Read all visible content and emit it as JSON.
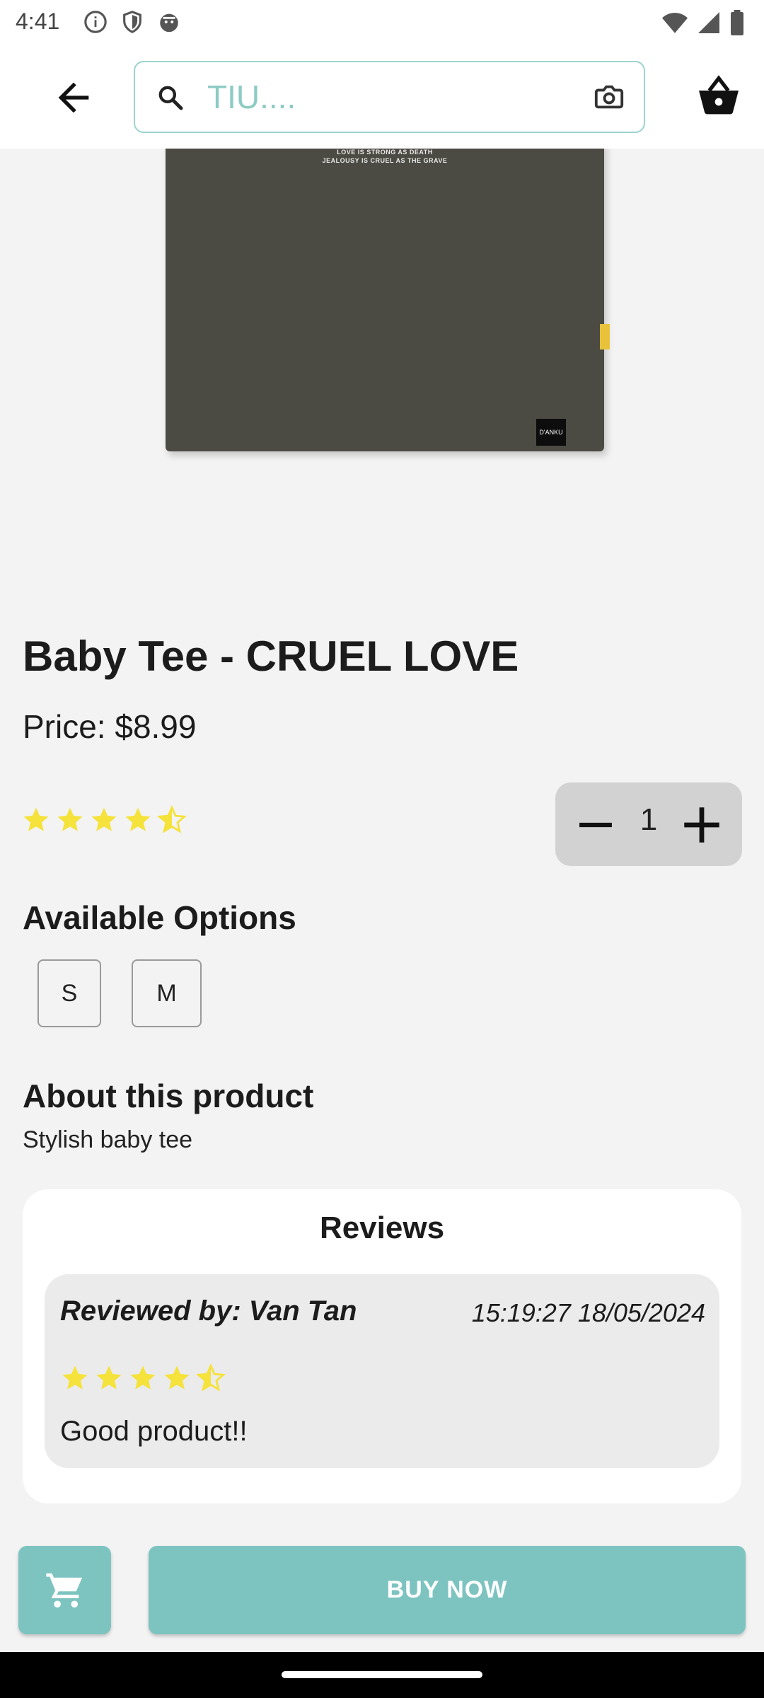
{
  "status_bar": {
    "time": "4:41",
    "icons_left": [
      "info-icon",
      "shield-icon",
      "cat-icon"
    ],
    "icons_right": [
      "wifi-icon",
      "signal-icon",
      "battery-icon"
    ]
  },
  "app_bar": {
    "back_icon": "arrow-back-icon",
    "search": {
      "value": "TIU....",
      "placeholder": "TIU...."
    },
    "search_icon": "search-icon",
    "camera_icon": "camera-icon",
    "basket_icon": "basket-icon"
  },
  "product_image": {
    "print_line_1": "LOVE IS STRONG AS DEATH",
    "print_line_2": "JEALOUSY IS CRUEL AS THE GRAVE",
    "label_text": "D'ANKU"
  },
  "product": {
    "title": "Baby Tee - CRUEL LOVE",
    "price": "Price: $8.99",
    "rating": 4.5,
    "quantity": "1"
  },
  "options": {
    "title": "Available Options",
    "sizes": [
      "S",
      "M"
    ]
  },
  "about": {
    "title": "About this product",
    "description": "Stylish baby tee"
  },
  "reviews": {
    "title": "Reviews",
    "items": [
      {
        "reviewer": "Reviewed by: Van Tan",
        "date": "15:19:27 18/05/2024",
        "rating": 4.5,
        "text": "Good product!!"
      }
    ]
  },
  "actions": {
    "cart_icon": "cart-icon",
    "buy_now": "BUY NOW"
  },
  "colors": {
    "accent": "#7dc4c1",
    "star": "#f5e23a",
    "background": "#f3f3f3"
  }
}
